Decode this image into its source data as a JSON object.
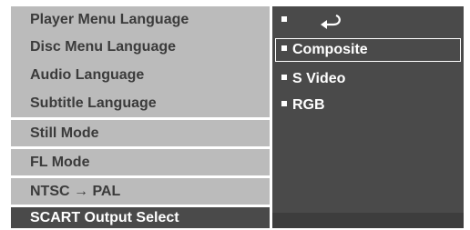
{
  "menu": {
    "items": [
      {
        "label": "Player Menu Language"
      },
      {
        "label": "Disc Menu Language"
      },
      {
        "label": "Audio Language"
      },
      {
        "label": "Subtitle Language"
      },
      {
        "label": "Still Mode"
      },
      {
        "label": "FL Mode"
      },
      {
        "label": "NTSC → PAL"
      },
      {
        "label": "SCART Output Select"
      }
    ],
    "selected_index": 7
  },
  "options": {
    "return_icon": "return-arrow-icon",
    "items": [
      {
        "label": "Composite",
        "selected": true
      },
      {
        "label": "S Video",
        "selected": false
      },
      {
        "label": "RGB",
        "selected": false
      }
    ]
  },
  "colors": {
    "menu_bg": "#bbbbbb",
    "menu_text": "#3b3b3b",
    "panel_bg": "#4a4a4a",
    "highlight_text": "#ffffff",
    "separator": "#ffffff"
  }
}
